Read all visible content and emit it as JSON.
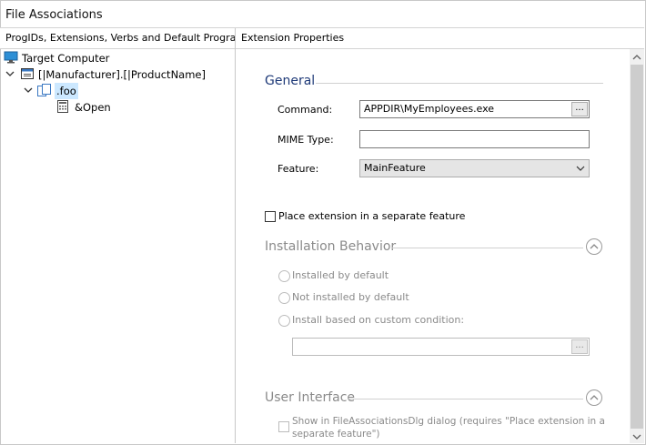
{
  "window": {
    "title": "File Associations"
  },
  "left_pane": {
    "header": "ProgIDs, Extensions, Verbs and Default Progra...",
    "tree": [
      {
        "label": "Target Computer",
        "icon": "monitor-icon"
      },
      {
        "label": "[|Manufacturer].[|ProductName]",
        "icon": "application-icon",
        "expanded": true
      },
      {
        "label": ".foo",
        "icon": "document-pages-icon",
        "expanded": true,
        "selected": true
      },
      {
        "label": "&Open",
        "icon": "verb-icon"
      }
    ]
  },
  "right_pane": {
    "header": "Extension Properties",
    "general": {
      "title": "General",
      "command_label": "Command:",
      "command_value": "APPDIR\\MyEmployees.exe",
      "browse_label": "...",
      "mime_label": "MIME Type:",
      "mime_value": "",
      "feature_label": "Feature:",
      "feature_value": "MainFeature",
      "separate_feature_label": "Place extension in a separate feature",
      "separate_feature_checked": false
    },
    "installation": {
      "title": "Installation Behavior",
      "options": [
        "Installed by default",
        "Not installed by default",
        "Install based on custom condition:"
      ],
      "condition_value": "",
      "browse_label": "..."
    },
    "user_interface": {
      "title": "User Interface",
      "show_dialog_label_line1": "Show in FileAssociationsDlg dialog (requires \"Place extension in a",
      "show_dialog_label_line2": "separate feature\")"
    }
  },
  "colors": {
    "accent_title": "#1f3a78",
    "disabled_text": "#8a8a8a",
    "selection": "#cce8ff"
  }
}
